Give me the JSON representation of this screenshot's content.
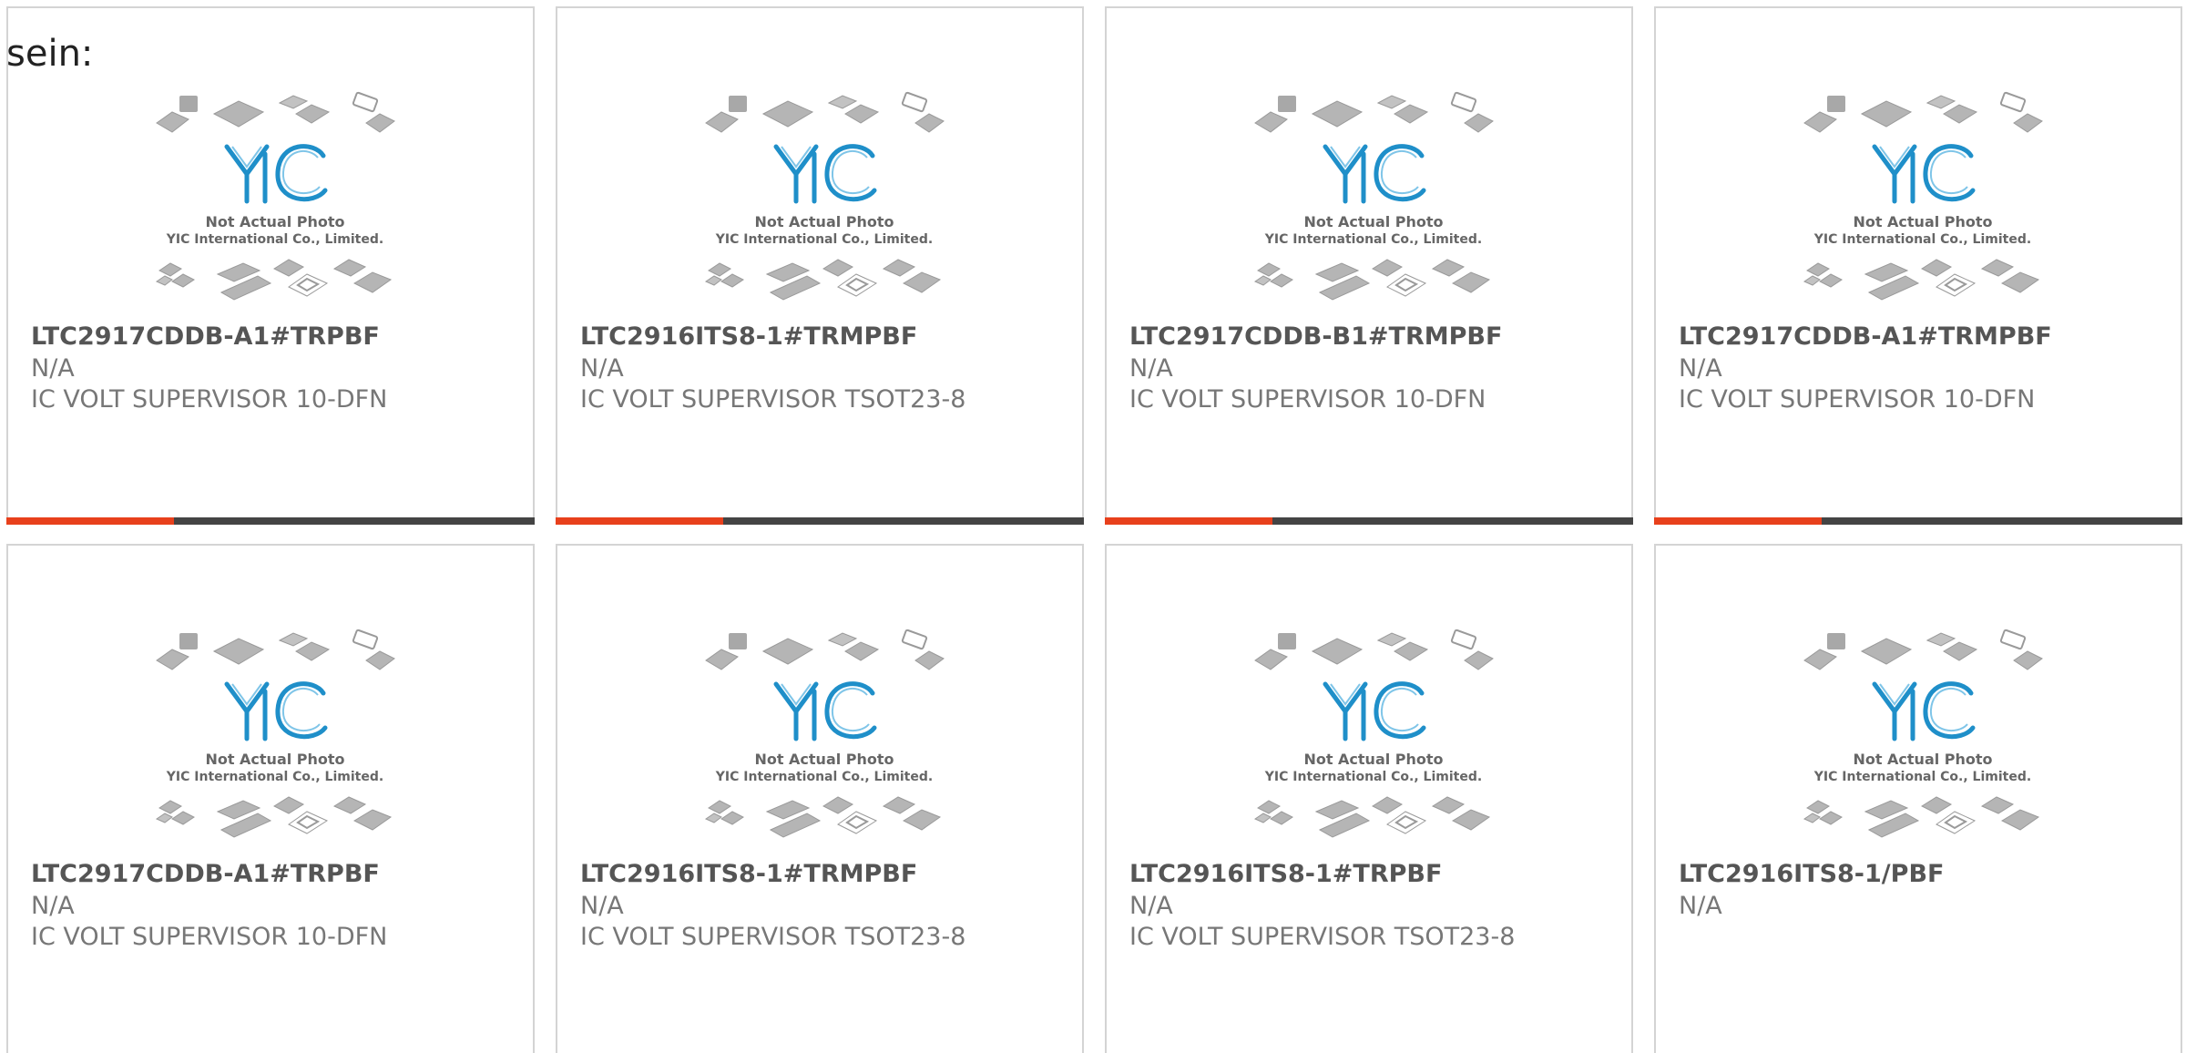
{
  "intro_text": "sein:",
  "colors": {
    "accent": "#e8401c",
    "bar_dark": "#444444",
    "logo_blue": "#1f8fc9",
    "package_gray": "#b5b5b5"
  },
  "placeholder": {
    "line1": "Not Actual Photo",
    "line2": "YIC International Co., Limited."
  },
  "products": [
    {
      "part": "LTC2917CDDB-A1#TRPBF",
      "manufacturer": "N/A",
      "description": "IC VOLT SUPERVISOR 10-DFN"
    },
    {
      "part": "LTC2916ITS8-1#TRMPBF",
      "manufacturer": "N/A",
      "description": "IC VOLT SUPERVISOR TSOT23-8"
    },
    {
      "part": "LTC2917CDDB-B1#TRMPBF",
      "manufacturer": "N/A",
      "description": "IC VOLT SUPERVISOR 10-DFN"
    },
    {
      "part": "LTC2917CDDB-A1#TRMPBF",
      "manufacturer": "N/A",
      "description": "IC VOLT SUPERVISOR 10-DFN"
    },
    {
      "part": "LTC2917CDDB-A1#TRPBF",
      "manufacturer": "N/A",
      "description": "IC VOLT SUPERVISOR 10-DFN"
    },
    {
      "part": "LTC2916ITS8-1#TRMPBF",
      "manufacturer": "N/A",
      "description": "IC VOLT SUPERVISOR TSOT23-8"
    },
    {
      "part": "LTC2916ITS8-1#TRPBF",
      "manufacturer": "N/A",
      "description": "IC VOLT SUPERVISOR TSOT23-8"
    },
    {
      "part": "LTC2916ITS8-1/PBF",
      "manufacturer": "N/A",
      "description": ""
    }
  ]
}
